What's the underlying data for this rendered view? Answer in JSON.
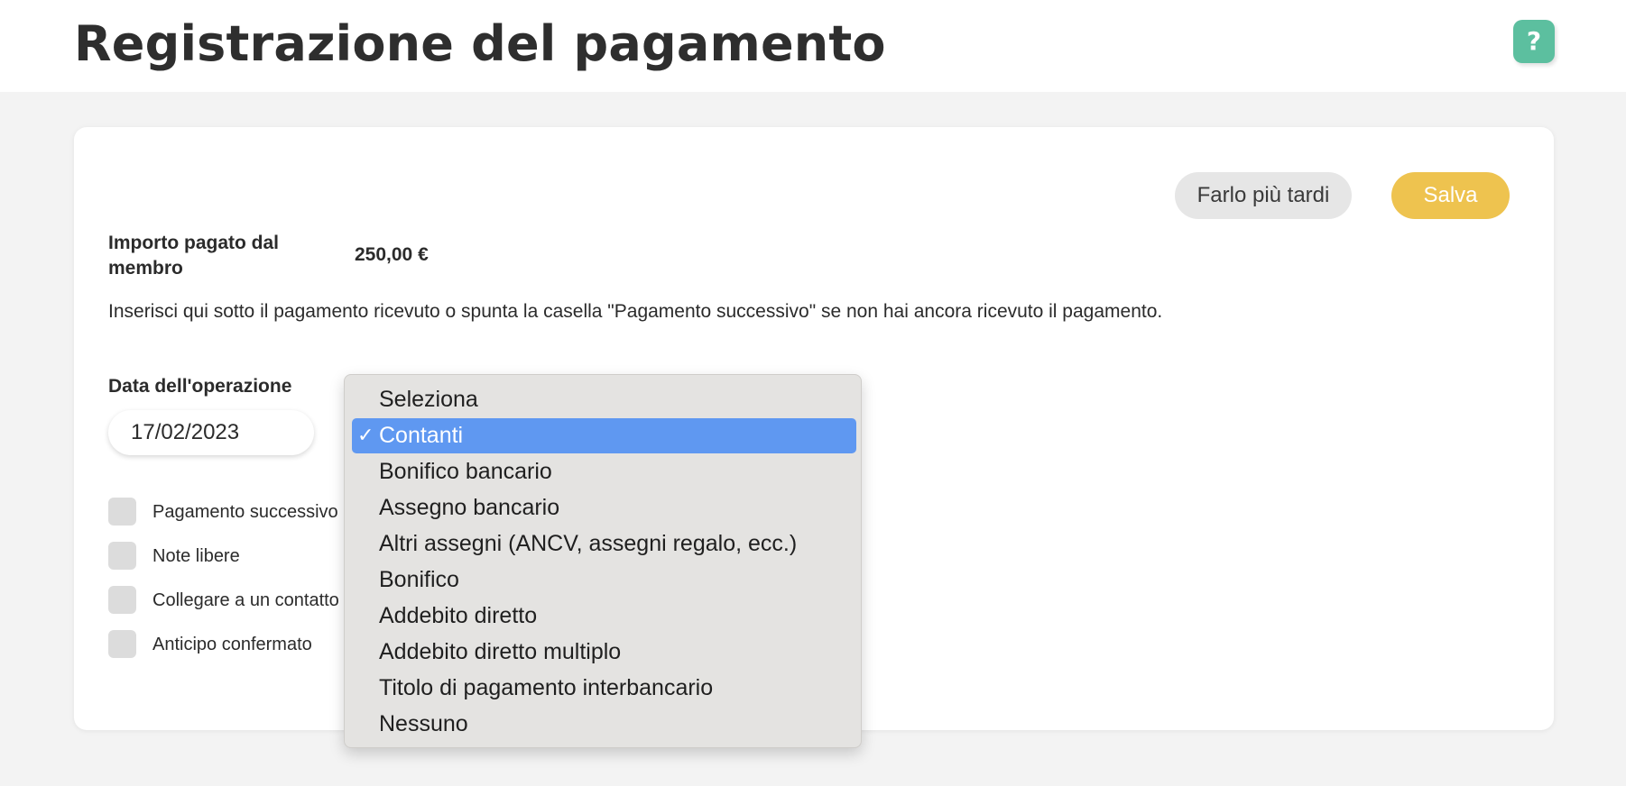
{
  "header": {
    "title": "Registrazione del pagamento",
    "help_label": "?"
  },
  "actions": {
    "later_label": "Farlo più tardi",
    "save_label": "Salva"
  },
  "amount": {
    "label": "Importo pagato dal membro",
    "value": "250,00 €"
  },
  "instructions": "Inserisci qui sotto il pagamento ricevuto o spunta la casella \"Pagamento successivo\" se non hai ancora ricevuto il pagamento.",
  "operation_date": {
    "label": "Data dell'operazione",
    "value": "17/02/2023"
  },
  "checkboxes": [
    {
      "label": "Pagamento successivo",
      "checked": false
    },
    {
      "label": "Note libere",
      "checked": false
    },
    {
      "label": "Collegare a un contatto",
      "checked": false
    },
    {
      "label": "Anticipo confermato",
      "checked": false
    }
  ],
  "payment_method_dropdown": {
    "selected": "Contanti",
    "checkmark": "✓",
    "options": [
      "Seleziona",
      "Contanti",
      "Bonifico bancario",
      "Assegno bancario",
      "Altri assegni (ANCV, assegni regalo, ecc.)",
      "Bonifico",
      "Addebito diretto",
      "Addebito diretto multiplo",
      "Titolo di pagamento interbancario",
      "Nessuno"
    ]
  },
  "colors": {
    "accent_help": "#5cbf9f",
    "save_button": "#eec34f",
    "selected_option": "#5f98f1"
  }
}
